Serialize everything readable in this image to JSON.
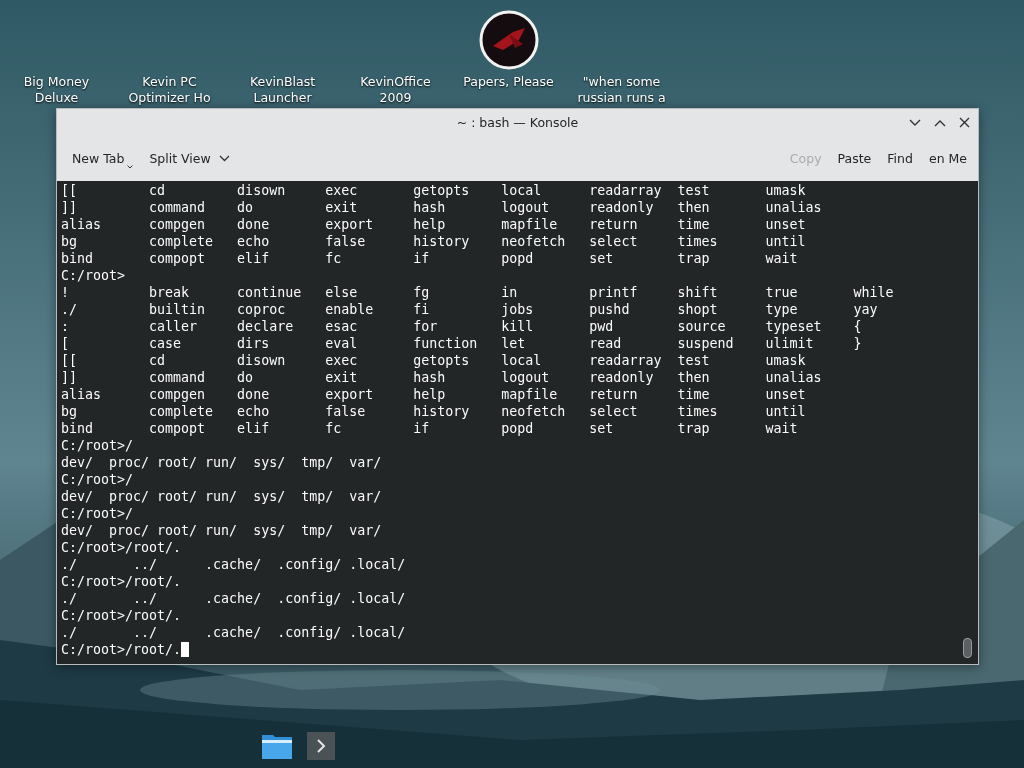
{
  "desktop_icons": [
    {
      "label": "Big Money Deluxe",
      "kind": "label"
    },
    {
      "label": "Kevin PC Optimizer Ho",
      "kind": "label"
    },
    {
      "label": "KevinBlast Launcher",
      "kind": "label"
    },
    {
      "label": "KevinOffice 2009",
      "kind": "label"
    },
    {
      "label": "Papers, Please",
      "kind": "app"
    },
    {
      "label": "\"when some russian runs a",
      "kind": "label"
    }
  ],
  "window": {
    "title": "~ : bash — Konsole"
  },
  "toolbar": {
    "left": [
      {
        "label": "New Tab",
        "kind": "split"
      },
      {
        "label": "Split View",
        "kind": "menu"
      }
    ],
    "right": [
      {
        "label": "Copy",
        "disabled": true
      },
      {
        "label": "Paste",
        "disabled": false
      },
      {
        "label": "Find",
        "disabled": false
      },
      {
        "label": "en Me",
        "disabled": false
      }
    ]
  },
  "terminal": {
    "lines": [
      "[[         cd         disown     exec       getopts    local      readarray  test       umask",
      "]]         command    do         exit       hash       logout     readonly   then       unalias",
      "alias      compgen    done       export     help       mapfile    return     time       unset",
      "bg         complete   echo       false      history    neofetch   select     times      until",
      "bind       compopt    elif       fc         if         popd       set        trap       wait",
      "C:/root>",
      "!          break      continue   else       fg         in         printf     shift      true       while",
      "./         builtin    coproc     enable     fi         jobs       pushd      shopt      type       yay",
      ":          caller     declare    esac       for        kill       pwd        source     typeset    {",
      "[          case       dirs       eval       function   let        read       suspend    ulimit     }",
      "[[         cd         disown     exec       getopts    local      readarray  test       umask",
      "]]         command    do         exit       hash       logout     readonly   then       unalias",
      "alias      compgen    done       export     help       mapfile    return     time       unset",
      "bg         complete   echo       false      history    neofetch   select     times      until",
      "bind       compopt    elif       fc         if         popd       set        trap       wait",
      "C:/root>/",
      "dev/  proc/ root/ run/  sys/  tmp/  var/",
      "C:/root>/",
      "dev/  proc/ root/ run/  sys/  tmp/  var/",
      "C:/root>/",
      "dev/  proc/ root/ run/  sys/  tmp/  var/",
      "C:/root>/root/.",
      "./       ../      .cache/  .config/ .local/",
      "C:/root>/root/.",
      "./       ../      .cache/  .config/ .local/",
      "C:/root>/root/.",
      "./       ../      .cache/  .config/ .local/",
      "C:/root>/root/."
    ]
  }
}
